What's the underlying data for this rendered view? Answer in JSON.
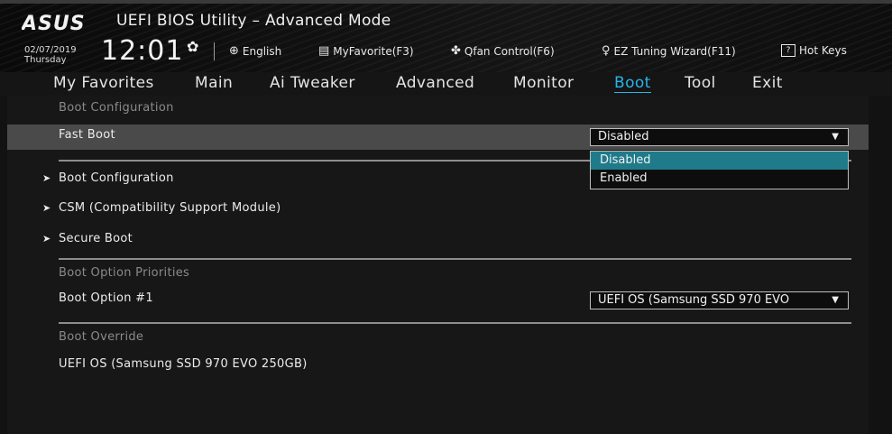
{
  "header": {
    "brand": "ASUS",
    "title": "UEFI BIOS Utility – Advanced Mode",
    "date": "02/07/2019",
    "day": "Thursday",
    "time": "12:01",
    "language": "English",
    "myfavorite": "MyFavorite(F3)",
    "qfan": "Qfan Control(F6)",
    "ez_tuning": "EZ Tuning Wizard(F11)",
    "hotkeys": "Hot Keys",
    "hotkeys_key": "?"
  },
  "tabs": [
    {
      "label": "My Favorites"
    },
    {
      "label": "Main"
    },
    {
      "label": "Ai Tweaker"
    },
    {
      "label": "Advanced"
    },
    {
      "label": "Monitor"
    },
    {
      "label": "Boot",
      "active": true
    },
    {
      "label": "Tool"
    },
    {
      "label": "Exit"
    }
  ],
  "main": {
    "section_boot_config": "Boot Configuration",
    "fast_boot_label": "Fast Boot",
    "fast_boot_value": "Disabled",
    "fast_boot_options": [
      "Disabled",
      "Enabled"
    ],
    "fast_boot_selected": "Disabled",
    "submenus": [
      "Boot Configuration",
      "CSM (Compatibility Support Module)",
      "Secure Boot"
    ],
    "section_priorities": "Boot Option Priorities",
    "boot_option1_label": "Boot Option #1",
    "boot_option1_value": "UEFI OS (Samsung SSD 970 EVO",
    "section_override": "Boot Override",
    "override_item": "UEFI OS (Samsung SSD 970 EVO 250GB)"
  },
  "colors": {
    "accent": "#27b5e9",
    "dropdown_selected": "#1f7a8a",
    "row_highlight": "#4a4a4a"
  },
  "icons": {
    "language": "globe-icon",
    "myfavorite": "keyboard-icon",
    "qfan": "fan-icon",
    "ez_tuning": "lightbulb-icon",
    "hotkeys": "question-box-icon",
    "settings": "gear-icon",
    "submenu": "triangle-right-icon",
    "select": "caret-down-icon"
  }
}
